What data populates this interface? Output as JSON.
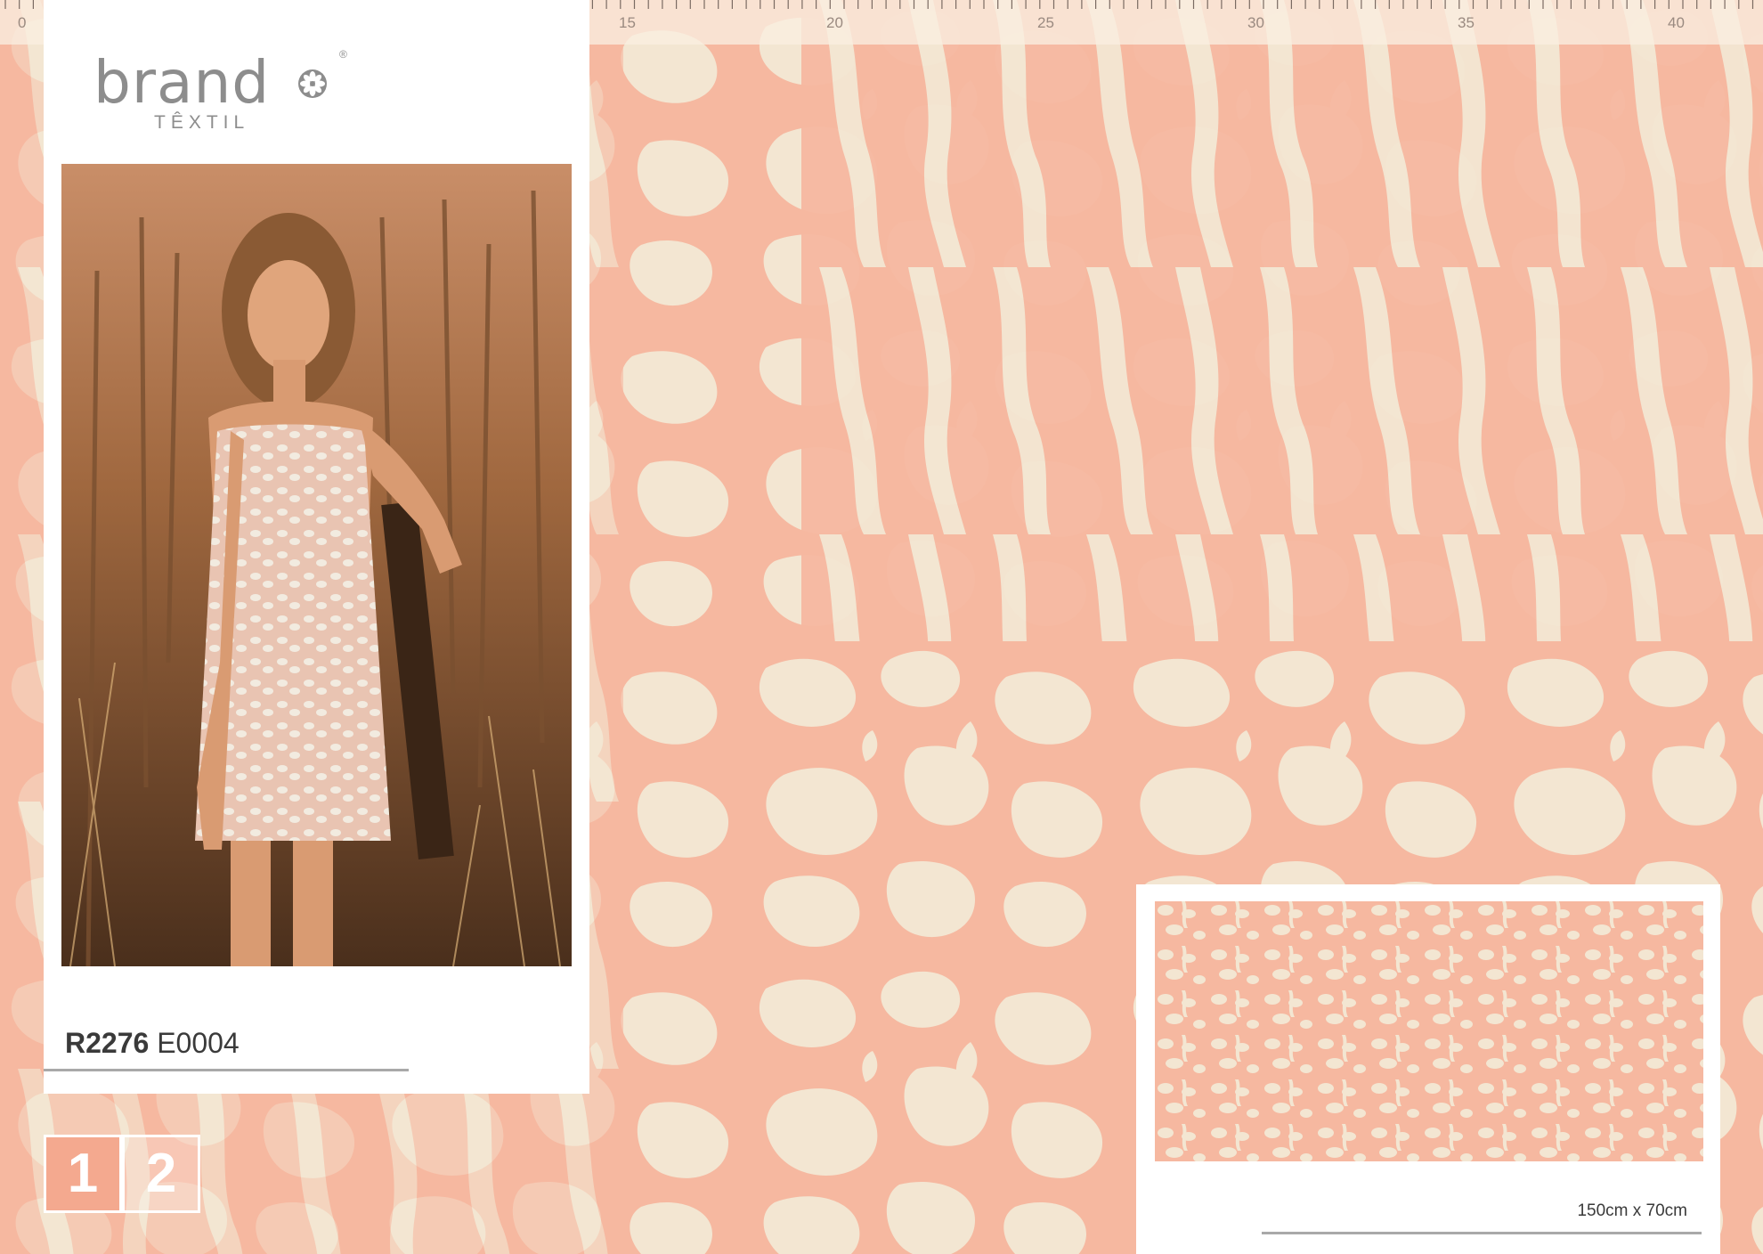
{
  "ruler": {
    "labels": [
      "0",
      "15",
      "20",
      "25",
      "30",
      "35",
      "40"
    ]
  },
  "brand": {
    "name": "brand",
    "subtitle": "TÊXTIL",
    "registered": "®",
    "icon": "flower-icon"
  },
  "product": {
    "code": "R2276",
    "variant": "E0004"
  },
  "pages": [
    "1",
    "2"
  ],
  "preview": {
    "size": "150cm x 70cm"
  },
  "colors": {
    "background": "#f6b8a0",
    "pattern_spots": "#f3e6d2",
    "accent_box": "#f4a98f"
  }
}
